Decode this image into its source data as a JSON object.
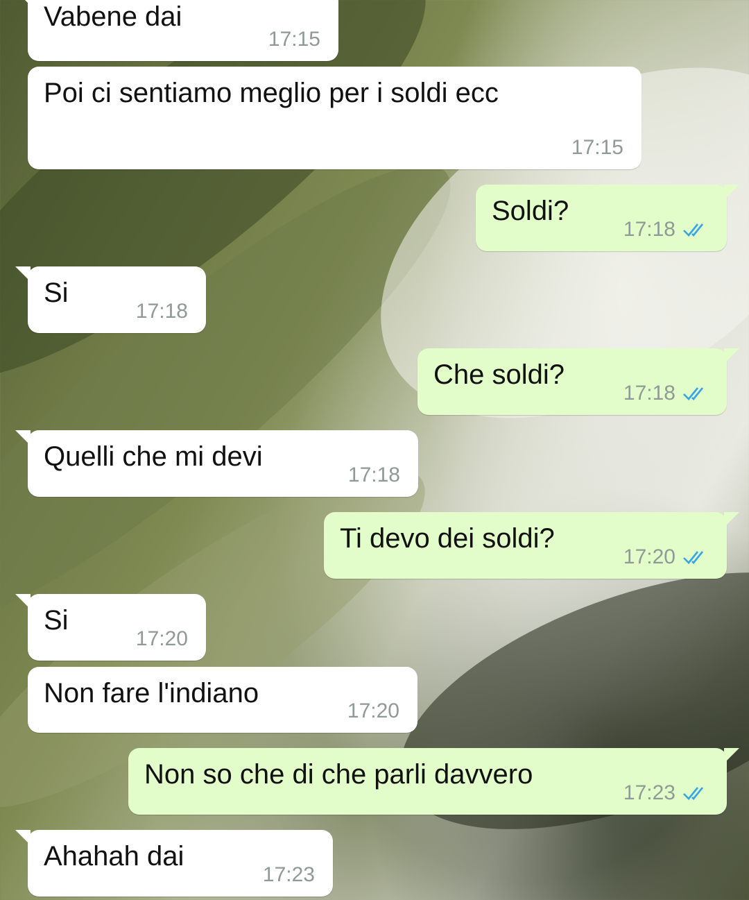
{
  "colors": {
    "incoming_bubble": "#ffffff",
    "outgoing_bubble": "#e2fdc9",
    "timestamp": "#8f9a97",
    "read_ticks": "#34a5e6"
  },
  "messages": [
    {
      "direction": "in",
      "text": "Vabene dai",
      "time": "17:15"
    },
    {
      "direction": "in",
      "text": "Poi ci sentiamo meglio per i soldi ecc",
      "time": "17:15"
    },
    {
      "direction": "out",
      "text": "Soldi?",
      "time": "17:18",
      "status_icon": "double-check-read-icon"
    },
    {
      "direction": "in",
      "text": "Si",
      "time": "17:18"
    },
    {
      "direction": "out",
      "text": "Che soldi?",
      "time": "17:18",
      "status_icon": "double-check-read-icon"
    },
    {
      "direction": "in",
      "text": "Quelli che mi devi",
      "time": "17:18"
    },
    {
      "direction": "out",
      "text": "Ti devo dei soldi?",
      "time": "17:20",
      "status_icon": "double-check-read-icon"
    },
    {
      "direction": "in",
      "text": "Si",
      "time": "17:20"
    },
    {
      "direction": "in",
      "text": "Non fare l'indiano",
      "time": "17:20"
    },
    {
      "direction": "out",
      "text": "Non so che di che parli davvero",
      "time": "17:23",
      "status_icon": "double-check-read-icon"
    },
    {
      "direction": "in",
      "text": "Ahahah dai",
      "time": "17:23"
    }
  ]
}
